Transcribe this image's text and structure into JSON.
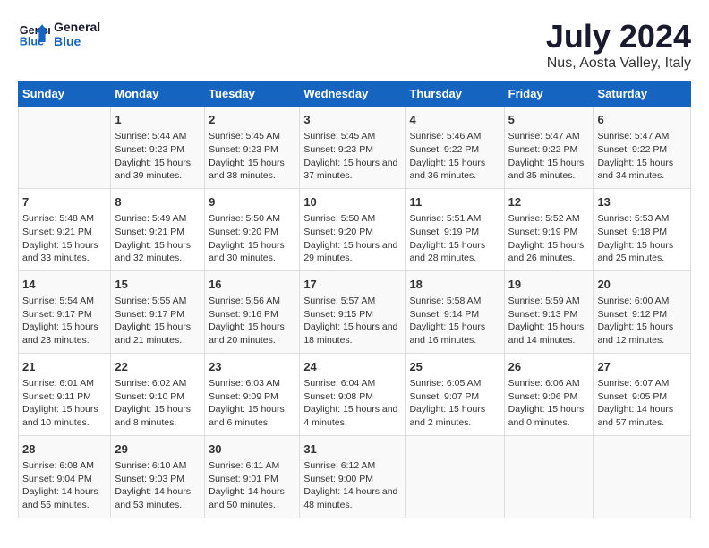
{
  "header": {
    "logo_line1": "General",
    "logo_line2": "Blue",
    "title": "July 2024",
    "subtitle": "Nus, Aosta Valley, Italy"
  },
  "days_of_week": [
    "Sunday",
    "Monday",
    "Tuesday",
    "Wednesday",
    "Thursday",
    "Friday",
    "Saturday"
  ],
  "weeks": [
    [
      {
        "day": "",
        "sunrise": "",
        "sunset": "",
        "daylight": ""
      },
      {
        "day": "1",
        "sunrise": "Sunrise: 5:44 AM",
        "sunset": "Sunset: 9:23 PM",
        "daylight": "Daylight: 15 hours and 39 minutes."
      },
      {
        "day": "2",
        "sunrise": "Sunrise: 5:45 AM",
        "sunset": "Sunset: 9:23 PM",
        "daylight": "Daylight: 15 hours and 38 minutes."
      },
      {
        "day": "3",
        "sunrise": "Sunrise: 5:45 AM",
        "sunset": "Sunset: 9:23 PM",
        "daylight": "Daylight: 15 hours and 37 minutes."
      },
      {
        "day": "4",
        "sunrise": "Sunrise: 5:46 AM",
        "sunset": "Sunset: 9:22 PM",
        "daylight": "Daylight: 15 hours and 36 minutes."
      },
      {
        "day": "5",
        "sunrise": "Sunrise: 5:47 AM",
        "sunset": "Sunset: 9:22 PM",
        "daylight": "Daylight: 15 hours and 35 minutes."
      },
      {
        "day": "6",
        "sunrise": "Sunrise: 5:47 AM",
        "sunset": "Sunset: 9:22 PM",
        "daylight": "Daylight: 15 hours and 34 minutes."
      }
    ],
    [
      {
        "day": "7",
        "sunrise": "Sunrise: 5:48 AM",
        "sunset": "Sunset: 9:21 PM",
        "daylight": "Daylight: 15 hours and 33 minutes."
      },
      {
        "day": "8",
        "sunrise": "Sunrise: 5:49 AM",
        "sunset": "Sunset: 9:21 PM",
        "daylight": "Daylight: 15 hours and 32 minutes."
      },
      {
        "day": "9",
        "sunrise": "Sunrise: 5:50 AM",
        "sunset": "Sunset: 9:20 PM",
        "daylight": "Daylight: 15 hours and 30 minutes."
      },
      {
        "day": "10",
        "sunrise": "Sunrise: 5:50 AM",
        "sunset": "Sunset: 9:20 PM",
        "daylight": "Daylight: 15 hours and 29 minutes."
      },
      {
        "day": "11",
        "sunrise": "Sunrise: 5:51 AM",
        "sunset": "Sunset: 9:19 PM",
        "daylight": "Daylight: 15 hours and 28 minutes."
      },
      {
        "day": "12",
        "sunrise": "Sunrise: 5:52 AM",
        "sunset": "Sunset: 9:19 PM",
        "daylight": "Daylight: 15 hours and 26 minutes."
      },
      {
        "day": "13",
        "sunrise": "Sunrise: 5:53 AM",
        "sunset": "Sunset: 9:18 PM",
        "daylight": "Daylight: 15 hours and 25 minutes."
      }
    ],
    [
      {
        "day": "14",
        "sunrise": "Sunrise: 5:54 AM",
        "sunset": "Sunset: 9:17 PM",
        "daylight": "Daylight: 15 hours and 23 minutes."
      },
      {
        "day": "15",
        "sunrise": "Sunrise: 5:55 AM",
        "sunset": "Sunset: 9:17 PM",
        "daylight": "Daylight: 15 hours and 21 minutes."
      },
      {
        "day": "16",
        "sunrise": "Sunrise: 5:56 AM",
        "sunset": "Sunset: 9:16 PM",
        "daylight": "Daylight: 15 hours and 20 minutes."
      },
      {
        "day": "17",
        "sunrise": "Sunrise: 5:57 AM",
        "sunset": "Sunset: 9:15 PM",
        "daylight": "Daylight: 15 hours and 18 minutes."
      },
      {
        "day": "18",
        "sunrise": "Sunrise: 5:58 AM",
        "sunset": "Sunset: 9:14 PM",
        "daylight": "Daylight: 15 hours and 16 minutes."
      },
      {
        "day": "19",
        "sunrise": "Sunrise: 5:59 AM",
        "sunset": "Sunset: 9:13 PM",
        "daylight": "Daylight: 15 hours and 14 minutes."
      },
      {
        "day": "20",
        "sunrise": "Sunrise: 6:00 AM",
        "sunset": "Sunset: 9:12 PM",
        "daylight": "Daylight: 15 hours and 12 minutes."
      }
    ],
    [
      {
        "day": "21",
        "sunrise": "Sunrise: 6:01 AM",
        "sunset": "Sunset: 9:11 PM",
        "daylight": "Daylight: 15 hours and 10 minutes."
      },
      {
        "day": "22",
        "sunrise": "Sunrise: 6:02 AM",
        "sunset": "Sunset: 9:10 PM",
        "daylight": "Daylight: 15 hours and 8 minutes."
      },
      {
        "day": "23",
        "sunrise": "Sunrise: 6:03 AM",
        "sunset": "Sunset: 9:09 PM",
        "daylight": "Daylight: 15 hours and 6 minutes."
      },
      {
        "day": "24",
        "sunrise": "Sunrise: 6:04 AM",
        "sunset": "Sunset: 9:08 PM",
        "daylight": "Daylight: 15 hours and 4 minutes."
      },
      {
        "day": "25",
        "sunrise": "Sunrise: 6:05 AM",
        "sunset": "Sunset: 9:07 PM",
        "daylight": "Daylight: 15 hours and 2 minutes."
      },
      {
        "day": "26",
        "sunrise": "Sunrise: 6:06 AM",
        "sunset": "Sunset: 9:06 PM",
        "daylight": "Daylight: 15 hours and 0 minutes."
      },
      {
        "day": "27",
        "sunrise": "Sunrise: 6:07 AM",
        "sunset": "Sunset: 9:05 PM",
        "daylight": "Daylight: 14 hours and 57 minutes."
      }
    ],
    [
      {
        "day": "28",
        "sunrise": "Sunrise: 6:08 AM",
        "sunset": "Sunset: 9:04 PM",
        "daylight": "Daylight: 14 hours and 55 minutes."
      },
      {
        "day": "29",
        "sunrise": "Sunrise: 6:10 AM",
        "sunset": "Sunset: 9:03 PM",
        "daylight": "Daylight: 14 hours and 53 minutes."
      },
      {
        "day": "30",
        "sunrise": "Sunrise: 6:11 AM",
        "sunset": "Sunset: 9:01 PM",
        "daylight": "Daylight: 14 hours and 50 minutes."
      },
      {
        "day": "31",
        "sunrise": "Sunrise: 6:12 AM",
        "sunset": "Sunset: 9:00 PM",
        "daylight": "Daylight: 14 hours and 48 minutes."
      },
      {
        "day": "",
        "sunrise": "",
        "sunset": "",
        "daylight": ""
      },
      {
        "day": "",
        "sunrise": "",
        "sunset": "",
        "daylight": ""
      },
      {
        "day": "",
        "sunrise": "",
        "sunset": "",
        "daylight": ""
      }
    ]
  ]
}
